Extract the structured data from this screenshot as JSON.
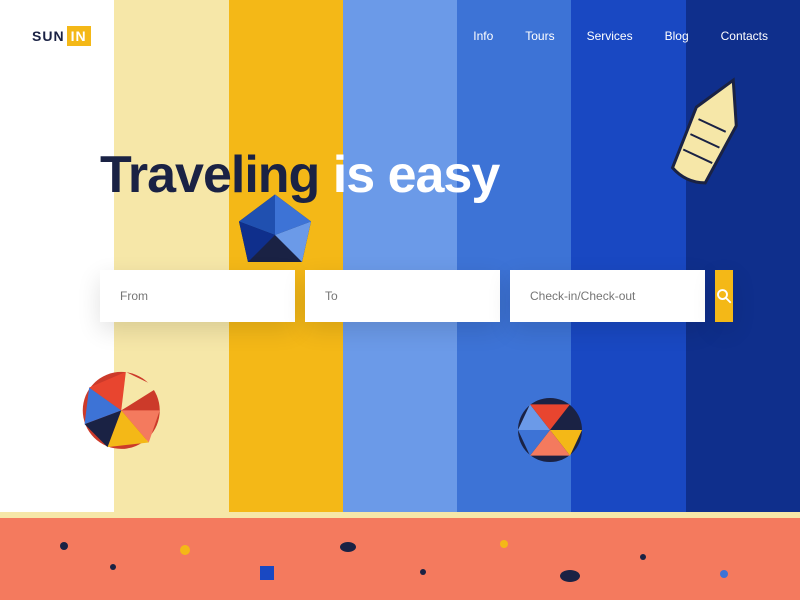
{
  "brand": {
    "name_a": "SUN",
    "name_b": "IN"
  },
  "nav": {
    "info": "Info",
    "tours": "Tours",
    "services": "Services",
    "blog": "Blog",
    "contacts": "Contacts"
  },
  "hero": {
    "w1": "Traveling",
    "w2": "is",
    "w3": "easy"
  },
  "search": {
    "from": "From",
    "to": "To",
    "dates": "Check-in/Check-out"
  },
  "colors": {
    "accent": "#f4b817",
    "coral": "#f47a5e",
    "dark": "#1a2244"
  }
}
